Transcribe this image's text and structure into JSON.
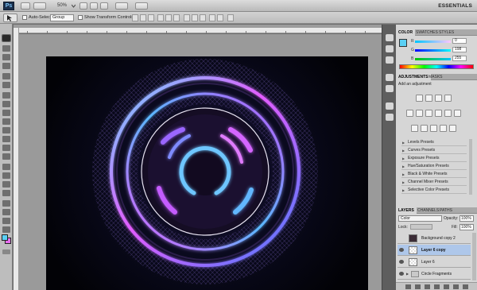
{
  "app": {
    "logo": "Ps",
    "zoom": "50%",
    "workspace": "ESSENTIALS"
  },
  "options": {
    "auto_select_label": "Auto-Select:",
    "auto_select_value": "Group",
    "transform_label": "Show Transform Controls"
  },
  "color_panel": {
    "tabs": [
      "COLOR",
      "SWATCHES",
      "STYLES"
    ],
    "r": {
      "label": "R",
      "value": "0"
    },
    "g": {
      "label": "G",
      "value": "198"
    },
    "b": {
      "label": "B",
      "value": "255"
    }
  },
  "adjustments_panel": {
    "tabs": [
      "ADJUSTMENTS",
      "MASKS"
    ],
    "heading": "Add an adjustment",
    "presets": [
      "Levels Presets",
      "Curves Presets",
      "Exposure Presets",
      "Hue/Saturation Presets",
      "Black & White Presets",
      "Channel Mixer Presets",
      "Selective Color Presets"
    ]
  },
  "layers_panel": {
    "tabs": [
      "LAYERS",
      "CHANNELS",
      "PATHS"
    ],
    "blend_mode": "Color",
    "opacity_label": "Opacity:",
    "opacity_value": "100%",
    "lock_label": "Lock:",
    "fill_label": "Fill:",
    "fill_value": "100%",
    "layers": [
      {
        "name": "Background copy 2"
      },
      {
        "name": "Layer 6 copy"
      },
      {
        "name": "Layer 6"
      },
      {
        "name": "Circle Fragments"
      }
    ]
  },
  "colors": {
    "foreground": "#5ad0f5",
    "background": "#e86ff0",
    "accent_cyan": "#4fc3ff",
    "accent_magenta": "#e15cff"
  }
}
